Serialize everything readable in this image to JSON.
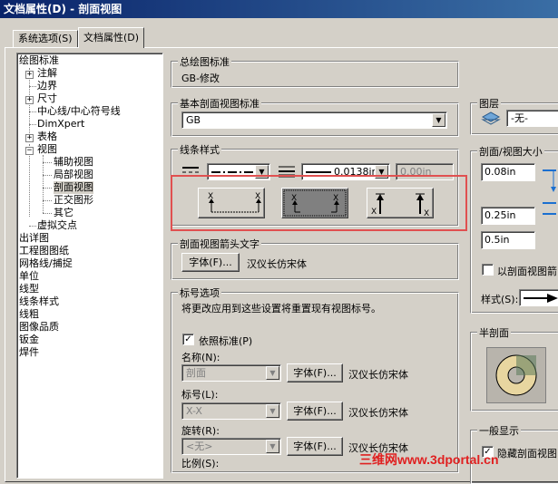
{
  "window": {
    "title": "文档属性(D) - 剖面视图"
  },
  "tabs": [
    {
      "label": "系统选项(S)"
    },
    {
      "label": "文档属性(D)"
    }
  ],
  "tree": {
    "items": [
      "绘图标准",
      "注解",
      "边界",
      "尺寸",
      "中心线/中心符号线",
      "DimXpert",
      "表格",
      "视图",
      "辅助视图",
      "局部视图",
      "剖面视图",
      "正交图形",
      "其它",
      "虚拟交点",
      "出详图",
      "工程图图纸",
      "网格线/捕捉",
      "单位",
      "线型",
      "线条样式",
      "线粗",
      "图像品质",
      "钣金",
      "焊件"
    ]
  },
  "overall_standard": {
    "label": "总绘图标准",
    "value": "GB-修改"
  },
  "base_standard": {
    "label": "基本剖面视图标准",
    "value": "GB"
  },
  "line_style": {
    "label": "线条样式",
    "thickness": "0.0138in",
    "custom": "0.00in"
  },
  "arrow_text": {
    "label": "剖面视图箭头文字",
    "font_button": "字体(F)...",
    "font_name": "汉仪长仿宋体"
  },
  "label_options": {
    "label": "标号选项",
    "note": "将更改应用到这些设置将重置现有视图标号。",
    "per_standard": "依照标准(P)",
    "name_label": "名称(N):",
    "name_value": "剖面",
    "id_label": "标号(L):",
    "id_value": "X-X",
    "rotate_label": "旋转(R):",
    "rotate_value": "<无>",
    "scale_label": "比例(S):",
    "font_button": "字体(F)...",
    "font_name": "汉仪长仿宋体"
  },
  "layer": {
    "label": "图层",
    "value": "-无-"
  },
  "section_size": {
    "label": "剖面/视图大小",
    "v1": "0.08in",
    "v2": "0.25in",
    "v3": "0.5in",
    "by_section": "以剖面视图箭",
    "style_label": "样式(S):"
  },
  "half_section": {
    "label": "半剖面"
  },
  "general_display": {
    "label": "一般显示",
    "item": "隐藏剖面视图"
  },
  "watermark": {
    "text": "三维网www.3dportal.cn"
  }
}
